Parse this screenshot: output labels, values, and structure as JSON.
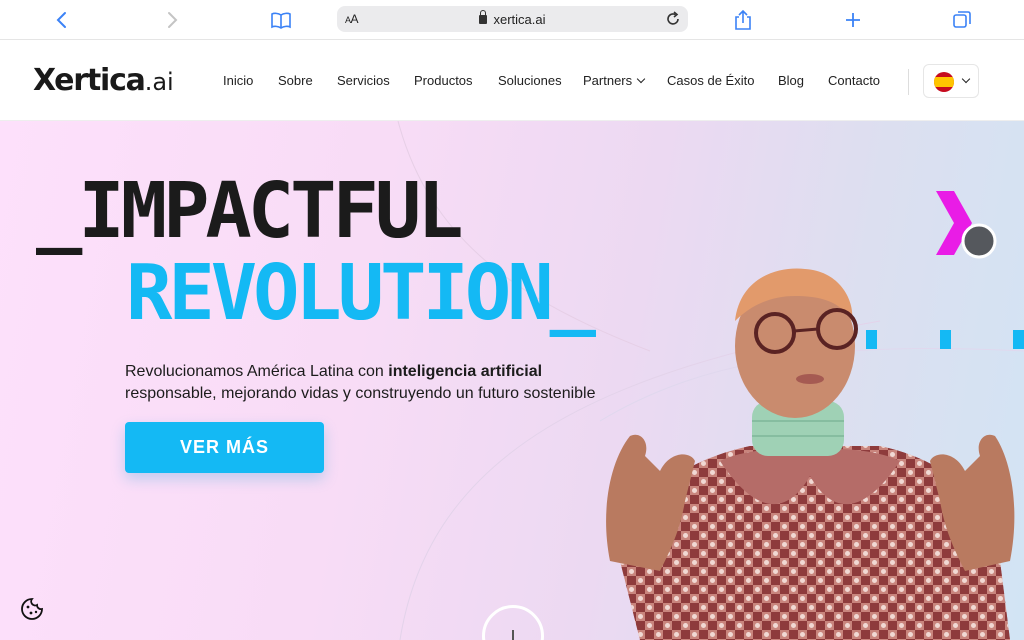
{
  "browser": {
    "url_host": "xertica.ai",
    "aa_label_small": "A",
    "aa_label_big": "A",
    "icons": [
      "back-icon",
      "forward-icon",
      "reader-book-icon",
      "lock-icon",
      "reload-icon",
      "share-icon",
      "new-tab-icon",
      "tabs-icon"
    ]
  },
  "header": {
    "logo_main": "Xertica",
    "logo_suffix": ".ai",
    "nav": [
      {
        "label": "Inicio"
      },
      {
        "label": "Sobre"
      },
      {
        "label": "Servicios"
      },
      {
        "label": "Productos"
      },
      {
        "label": "Soluciones"
      },
      {
        "label": "Partners"
      },
      {
        "label": "Casos de Éxito"
      },
      {
        "label": "Blog"
      },
      {
        "label": "Contacto"
      }
    ],
    "language_flag": "spain-flag-icon"
  },
  "hero": {
    "headline_line1": "_IMPACTFUL",
    "headline_line2": "REVOLUTION_",
    "text_part1": "Revolucionamos América Latina con ",
    "text_bold": "inteligencia artificial",
    "text_part2": "responsable, mejorando vidas y construyendo un futuro sostenible",
    "cta_label": "VER MÁS"
  },
  "colors": {
    "accent_blue": "#14b9f4",
    "accent_magenta": "#e91ce6",
    "headline_dark": "#1b1b1b"
  }
}
